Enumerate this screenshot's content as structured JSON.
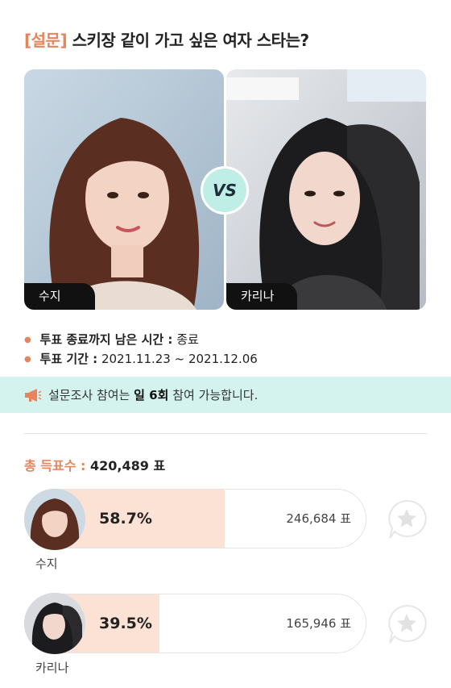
{
  "poll": {
    "tag": "[설문]",
    "question": "스키장 같이 가고 싶은 여자 스타는?",
    "vs_label": "VS",
    "info": {
      "remaining_label": "투표 종료까지 남은 시간 :",
      "remaining_value": "종료",
      "period_label": "투표 기간 :",
      "period_value": "2021.11.23 ~ 2021.12.06"
    },
    "notice": {
      "prefix": "설문조사 참여는",
      "highlight": "일 6회",
      "suffix": "참여 가능합니다."
    },
    "total": {
      "label": "총 득표수 :",
      "value": "420,489 표"
    },
    "candidates": [
      {
        "name": "수지",
        "percent_label": "58.7%",
        "share": 0.587,
        "votes": "246,684 표"
      },
      {
        "name": "카리나",
        "percent_label": "39.5%",
        "share": 0.395,
        "votes": "165,946 표"
      }
    ]
  },
  "colors": {
    "accent": "#e8845c",
    "notice_bg": "#d4f3ef",
    "vs_bg": "#bfeee6",
    "bar_fill": "#fce1d5"
  },
  "icons": {
    "notice": "megaphone-icon",
    "vote": "star-speech-bubble-icon"
  }
}
